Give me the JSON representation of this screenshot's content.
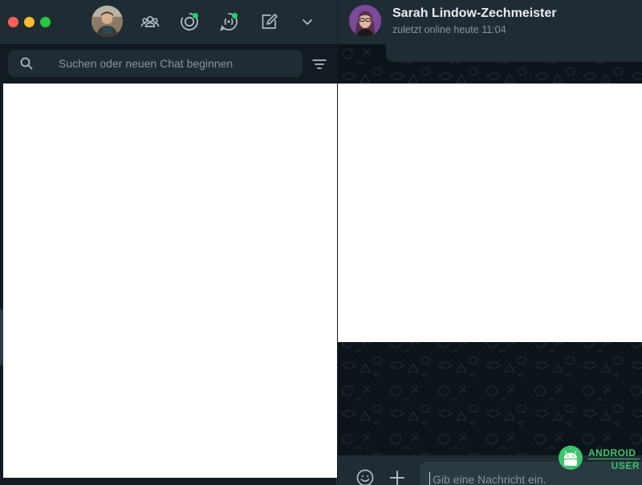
{
  "window": {
    "controls": [
      "close",
      "minimize",
      "zoom"
    ]
  },
  "toolbar": {
    "icons": [
      "communities-icon",
      "status-icon",
      "channels-icon",
      "new-chat-icon",
      "chevron-down-icon"
    ],
    "accent_color": "#25d366"
  },
  "search": {
    "placeholder": "Suchen oder neuen Chat beginnen"
  },
  "chat": {
    "contact_name": "Sarah Lindow-Zechmeister",
    "status": "zuletzt online heute 11:04"
  },
  "compose": {
    "placeholder": "Gib eine Nachricht ein."
  },
  "watermark": {
    "line1": "ANDROID",
    "line2": "USER"
  }
}
